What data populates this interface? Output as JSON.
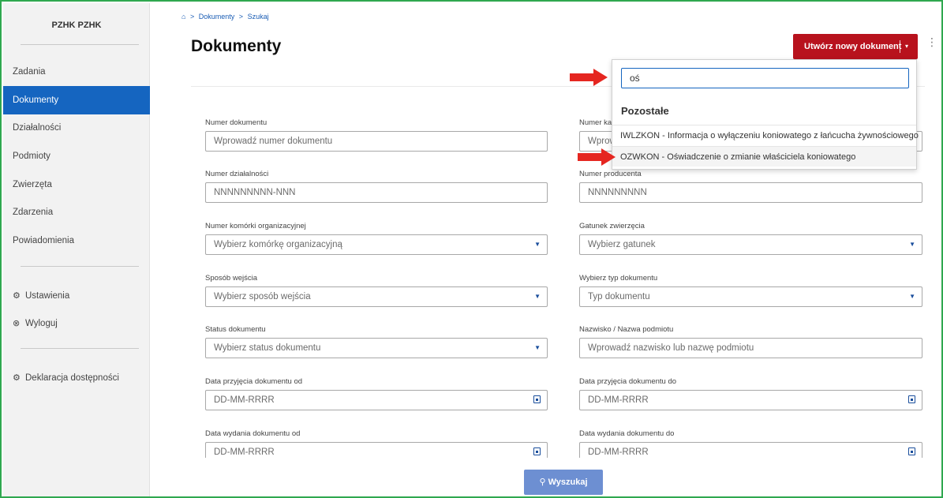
{
  "sidebar": {
    "user": "PZHK PZHK",
    "nav": [
      {
        "label": "Zadania"
      },
      {
        "label": "Dokumenty"
      },
      {
        "label": "Działalności"
      },
      {
        "label": "Podmioty"
      },
      {
        "label": "Zwierzęta"
      },
      {
        "label": "Zdarzenia"
      },
      {
        "label": "Powiadomienia"
      }
    ],
    "settings_label": "Ustawienia",
    "logout_label": "Wyloguj",
    "accessibility_label": "Deklaracja dostępności"
  },
  "breadcrumb": {
    "home_icon": "home-icon",
    "sep": ">",
    "items": [
      "Dokumenty",
      "Szukaj"
    ]
  },
  "header": {
    "title": "Dokumenty",
    "create_button": "Utwórz nowy dokument"
  },
  "form": {
    "fields": [
      {
        "label": "Numer dokumentu",
        "placeholder": "Wprowadź numer dokumentu"
      },
      {
        "label": "Numer ka",
        "placeholder": "Wprow"
      },
      {
        "label": "Numer działalności",
        "placeholder": "NNNNNNNNN-NNN"
      },
      {
        "label": "Numer producenta",
        "placeholder": "NNNNNNNNN"
      },
      {
        "label": "Numer komórki organizacyjnej",
        "placeholder": "Wybierz komórkę organizacyjną"
      },
      {
        "label": "Gatunek zwierzęcia",
        "placeholder": "Wybierz gatunek"
      },
      {
        "label": "Sposób wejścia",
        "placeholder": "Wybierz sposób wejścia"
      },
      {
        "label": "Wybierz typ dokumentu",
        "placeholder": "Typ dokumentu"
      },
      {
        "label": "Status dokumentu",
        "placeholder": "Wybierz status dokumentu"
      },
      {
        "label": "Nazwisko / Nazwa podmiotu",
        "placeholder": "Wprowadź nazwisko lub nazwę podmiotu"
      },
      {
        "label": "Data przyjęcia dokumentu od",
        "placeholder": "DD-MM-RRRR"
      },
      {
        "label": "Data przyjęcia dokumentu do",
        "placeholder": "DD-MM-RRRR"
      },
      {
        "label": "Data wydania dokumentu od",
        "placeholder": "DD-MM-RRRR"
      },
      {
        "label": "Data wydania dokumentu do",
        "placeholder": "DD-MM-RRRR"
      }
    ],
    "search_button": "Wyszukaj"
  },
  "dropdown": {
    "search_value": "oś",
    "group_label": "Pozostałe",
    "options": [
      "IWLZKON - Informacja o wyłączeniu koniowatego z łańcucha żywnościowego",
      "OZWKON - Oświadczenie o zmianie właściciela koniowatego"
    ]
  },
  "colors": {
    "accent_blue": "#1565c0",
    "create_red": "#b8121d",
    "search_button": "#6d8fd2",
    "frame_green": "#2fa84f",
    "annotation_arrow": "#e52620"
  }
}
